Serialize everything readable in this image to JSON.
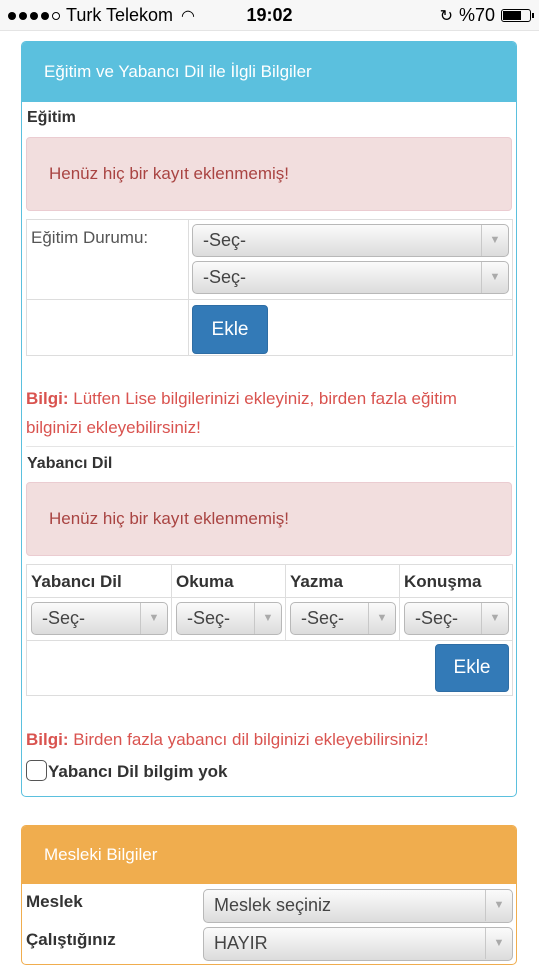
{
  "status_bar": {
    "carrier": "Turk Telekom",
    "time": "19:02",
    "battery": "%70",
    "battery_level": 0.7
  },
  "education_panel": {
    "title": "Eğitim ve Yabancı Dil ile İlgli Bilgiler",
    "education": {
      "section_title": "Eğitim",
      "empty_alert": "Henüz hiç bir kayıt eklenmemiş!",
      "status_label": "Eğitim Durumu:",
      "select1_value": "-Seç-",
      "select2_value": "-Seç-",
      "add_button": "Ekle",
      "info_prefix": "Bilgi:",
      "info_text": "Lütfen Lise bilgilerinizi ekleyiniz, birden fazla eğitim bilginizi ekleyebilirsiniz!"
    },
    "language": {
      "section_title": "Yabancı Dil",
      "empty_alert": "Henüz hiç bir kayıt eklenmemiş!",
      "columns": [
        "Yabancı Dil",
        "Okuma",
        "Yazma",
        "Konuşma"
      ],
      "select_values": [
        "-Seç-",
        "-Seç-",
        "-Seç-",
        "-Seç-"
      ],
      "add_button": "Ekle",
      "info_prefix": "Bilgi:",
      "info_text": "Birden fazla yabancı dil bilginizi ekleyebilirsiniz!",
      "no_language_label": "Yabancı Dil bilgim yok"
    }
  },
  "professional_panel": {
    "title": "Mesleki Bilgiler",
    "profession_label": "Meslek",
    "profession_value": "Meslek seçiniz",
    "working_label": "Çalıştığınız",
    "working_value": "HAYIR"
  }
}
